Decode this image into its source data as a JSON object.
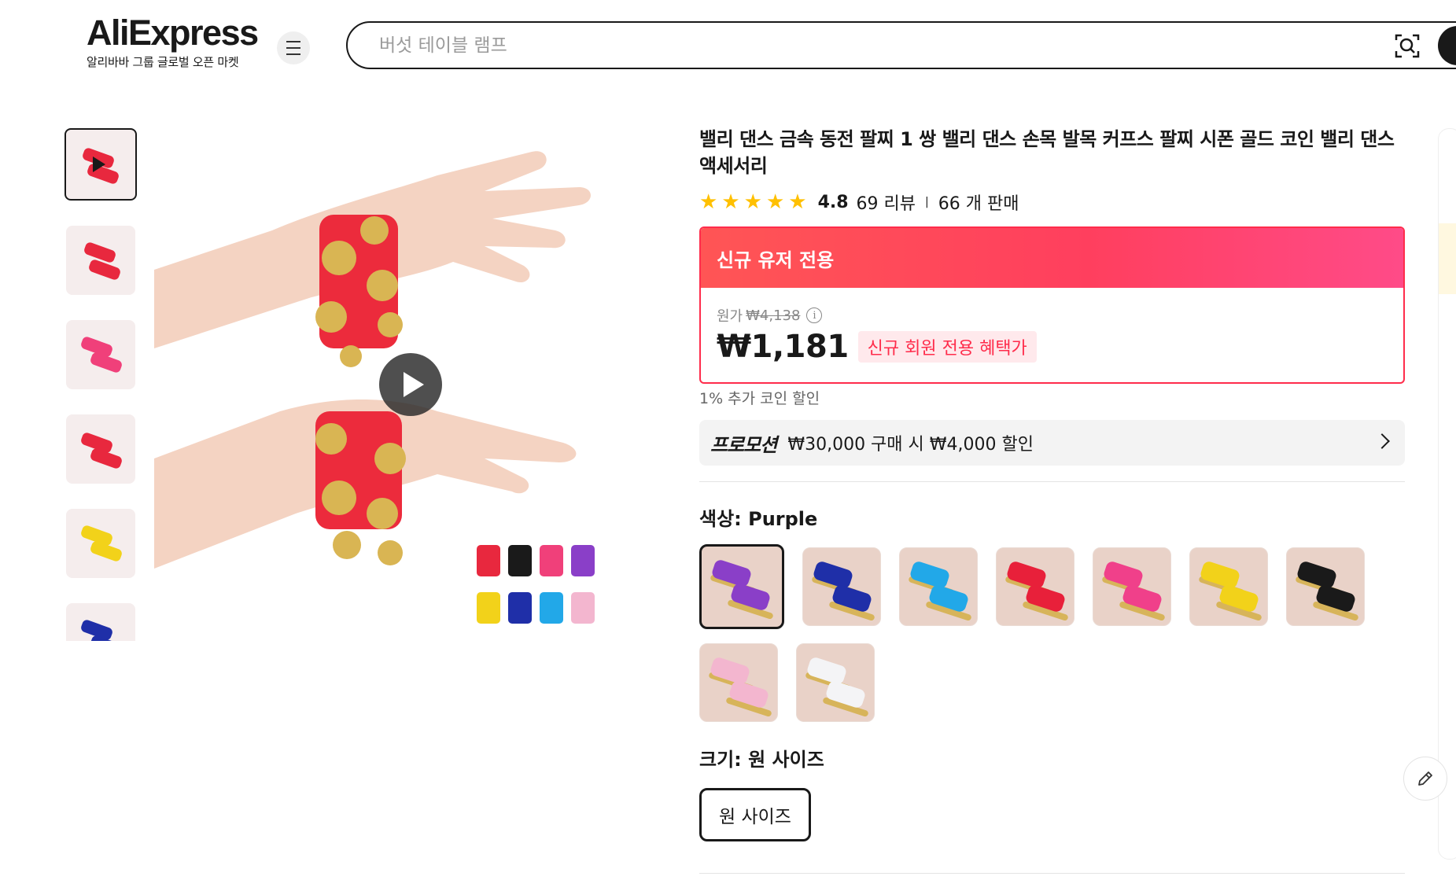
{
  "header": {
    "logo_text": "AliExpress",
    "logo_subtitle": "알리바바 그룹 글로벌 오픈 마켓",
    "search_placeholder": "버섯 테이블 램프"
  },
  "product": {
    "title": "밸리 댄스 금속 동전 팔찌 1 쌍 밸리 댄스 손목 발목 커프스 팔찌 시폰 골드 코인 밸리 댄스 액세서리",
    "rating": "4.8",
    "reviews": "69 리뷰",
    "sold": "66 개 판매",
    "stars_count": 5
  },
  "deal": {
    "banner": "신규 유저 전용",
    "original_label": "원가",
    "original_price": "₩4,138",
    "price": "₩1,181",
    "badge": "신규 회원 전용 혜택가"
  },
  "coin_text": "1% 추가 코인 할인",
  "promotion": {
    "tag": "프로모션",
    "text": "₩30,000 구매 시 ₩4,000 할인"
  },
  "color": {
    "label": "색상: Purple",
    "selected": "Purple",
    "options": [
      {
        "name": "Purple",
        "hex": "#8a3fc8"
      },
      {
        "name": "Blue",
        "hex": "#1f2fa8"
      },
      {
        "name": "Sky Blue",
        "hex": "#22a8e8"
      },
      {
        "name": "Red",
        "hex": "#e8203a"
      },
      {
        "name": "Rose",
        "hex": "#f0408a"
      },
      {
        "name": "Yellow",
        "hex": "#f2d21a"
      },
      {
        "name": "Black",
        "hex": "#1a1a1a"
      },
      {
        "name": "Pink",
        "hex": "#f3b6cf"
      },
      {
        "name": "White",
        "hex": "#f4f4f6"
      }
    ]
  },
  "size": {
    "label": "크기: 원 사이즈",
    "option": "원 사이즈"
  },
  "thumbnails": [
    {
      "type": "video",
      "hex": "#e8283e"
    },
    {
      "type": "image",
      "hex": "#e8283e"
    },
    {
      "type": "image",
      "hex": "#f0407a"
    },
    {
      "type": "image",
      "hex": "#e8283e"
    },
    {
      "type": "image",
      "hex": "#f2d21a"
    },
    {
      "type": "image",
      "hex": "#1f2fa8"
    }
  ],
  "colors": {
    "accent": "#ff2c4b",
    "star": "#ffc000"
  }
}
